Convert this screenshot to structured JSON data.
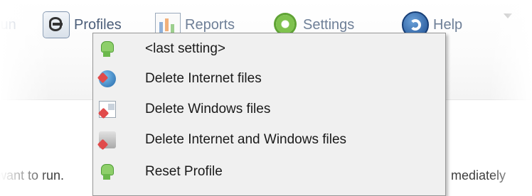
{
  "toolbar": {
    "run_label": "Run",
    "profiles_label": "Profiles",
    "reports_label": "Reports",
    "settings_label": "Settings",
    "help_label": "Help",
    "icons": {
      "profiles": "profiles-icon",
      "reports": "reports-icon",
      "settings": "gear-icon",
      "help": "help-icon",
      "dropdown": "chevron-down-icon"
    }
  },
  "profiles_menu": {
    "items": [
      {
        "label": "<last setting>",
        "icon": "robot-icon"
      },
      {
        "label": "Delete Internet files",
        "icon": "globe-delete-icon"
      },
      {
        "label": "Delete Windows files",
        "icon": "windows-file-delete-icon"
      },
      {
        "label": "Delete Internet and Windows files",
        "icon": "drive-delete-icon"
      },
      {
        "label": "Reset Profile",
        "icon": "robot-reset-icon"
      }
    ]
  },
  "body_text": {
    "left_fragment": "want to run.",
    "right_fragment": "mediately"
  },
  "colors": {
    "toolbar_text": "#6e7f97",
    "menu_background": "#f0f0f0",
    "menu_border": "#979797"
  }
}
